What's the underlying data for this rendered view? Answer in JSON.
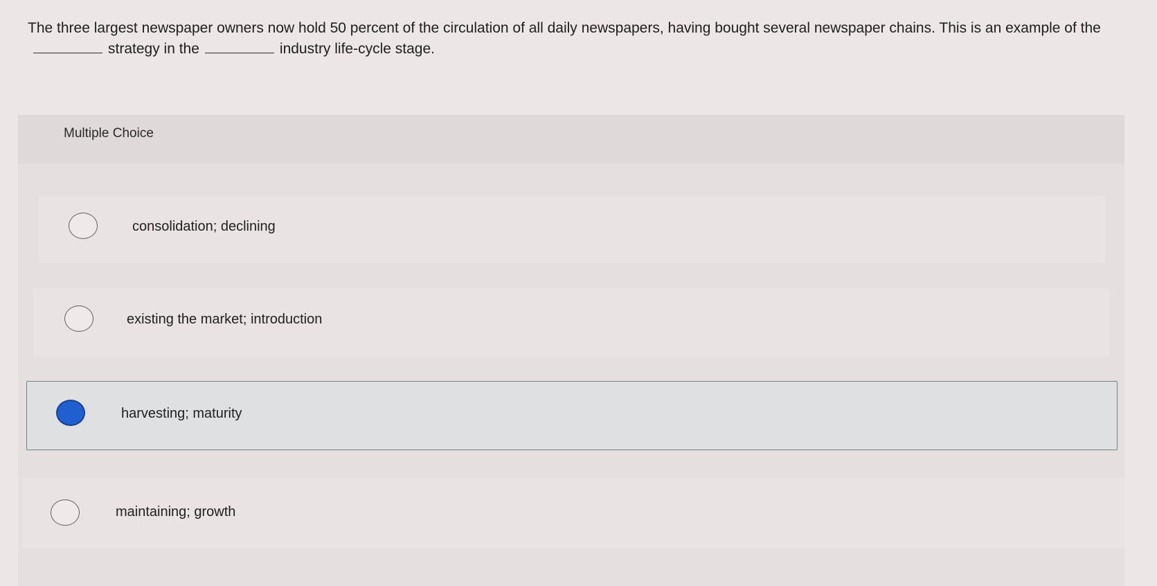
{
  "question": {
    "part1": "The three largest newspaper owners now hold 50 percent of the circulation of all daily newspapers, having bought several newspaper chains. This is an example of the",
    "part2": "strategy in the",
    "part3": "industry life-cycle stage."
  },
  "multiple_choice": {
    "title": "Multiple Choice",
    "options": [
      {
        "label": "consolidation; declining",
        "selected": false
      },
      {
        "label": "existing the market; introduction",
        "selected": false
      },
      {
        "label": "harvesting; maturity",
        "selected": true
      },
      {
        "label": "maintaining; growth",
        "selected": false
      }
    ],
    "selected_color": "#1f5fd0"
  }
}
